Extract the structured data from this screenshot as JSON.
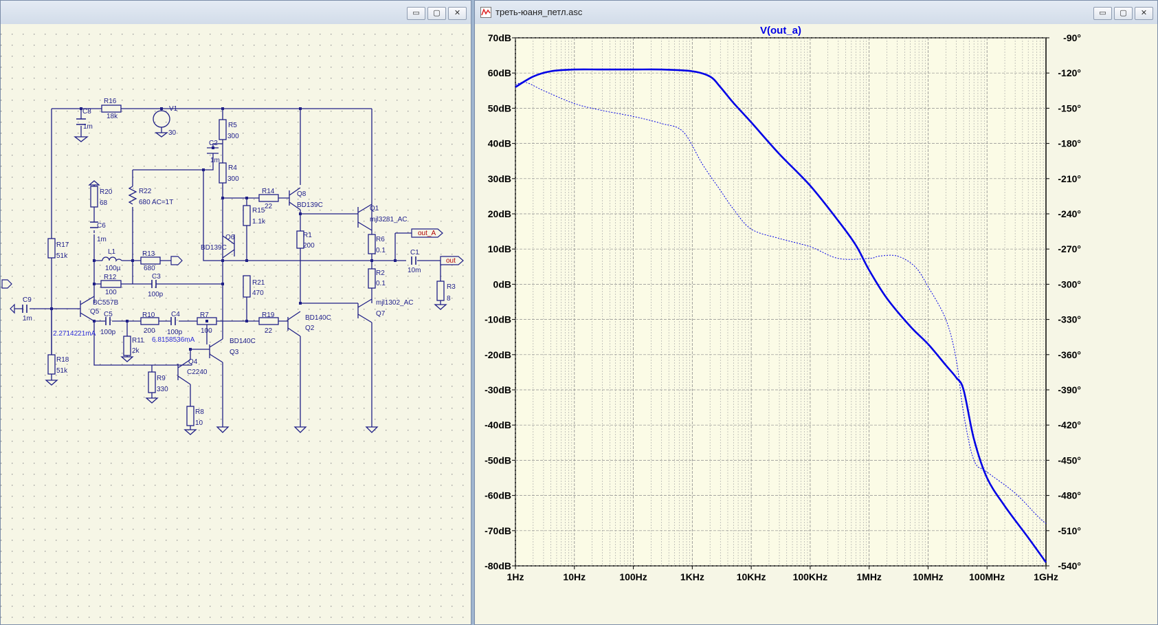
{
  "schematic_window": {
    "buttons": {
      "minimize": "▭",
      "restore": "▢",
      "close": "✕"
    },
    "components": [
      {
        "name": "R16",
        "value": "18k"
      },
      {
        "name": "C8",
        "value": "1m"
      },
      {
        "name": "V1",
        "value": "30"
      },
      {
        "name": "R5",
        "value": "300"
      },
      {
        "name": "C2",
        "value": "1m"
      },
      {
        "name": "R4",
        "value": "300"
      },
      {
        "name": "R20",
        "value": "68"
      },
      {
        "name": "R22",
        "value": "680 AC=1T"
      },
      {
        "name": "R14",
        "value": "22"
      },
      {
        "name": "Q8",
        "value": "BD139C"
      },
      {
        "name": "R15",
        "value": "1.1k"
      },
      {
        "name": "Q1",
        "value": "mjl3281_AC"
      },
      {
        "name": "C6",
        "value": "1m"
      },
      {
        "name": "Q6",
        "value": "BD139C"
      },
      {
        "name": "R1",
        "value": "200"
      },
      {
        "name": "R6",
        "value": "0.1"
      },
      {
        "name": "L1",
        "value": "100µ"
      },
      {
        "name": "R13",
        "value": "680"
      },
      {
        "name": "R17",
        "value": "51k"
      },
      {
        "name": "C1",
        "value": "10m"
      },
      {
        "name": "R12",
        "value": "100"
      },
      {
        "name": "C3",
        "value": "100p"
      },
      {
        "name": "R21",
        "value": "470"
      },
      {
        "name": "R2",
        "value": "0.1"
      },
      {
        "name": "R3",
        "value": "8"
      },
      {
        "name": "C9",
        "value": "1m"
      },
      {
        "name": "Q5",
        "value": "BC557B"
      },
      {
        "name": "Q7",
        "value": "mjl1302_AC"
      },
      {
        "name": "C5",
        "value": "100p"
      },
      {
        "name": "R10",
        "value": "200"
      },
      {
        "name": "C4",
        "value": "100p"
      },
      {
        "name": "R7",
        "value": "100"
      },
      {
        "name": "R19",
        "value": "22"
      },
      {
        "name": "Q2",
        "value": "BD140C"
      },
      {
        "name": "R11",
        "value": "2k"
      },
      {
        "name": "Q3",
        "value": "BD140C"
      },
      {
        "name": "Q4",
        "value": "C2240"
      },
      {
        "name": "R18",
        "value": "51k"
      },
      {
        "name": "R9",
        "value": "330"
      },
      {
        "name": "R8",
        "value": "10"
      }
    ],
    "net_labels": {
      "out_a": "out_A",
      "out": "out"
    },
    "annotations": {
      "current_q5": "2.2714221mA",
      "current_q4": "6.8158536mA"
    }
  },
  "plot_window": {
    "title": "треть-юаня_петл.asc",
    "buttons": {
      "minimize": "▭",
      "restore": "▢",
      "close": "✕"
    },
    "accent_color": "#0000e6",
    "background_color": "#fbfbe6"
  },
  "chart_data": {
    "type": "line",
    "title": "V(out_a)",
    "x_scale": "log",
    "x_ticks": [
      "1Hz",
      "10Hz",
      "100Hz",
      "1KHz",
      "10KHz",
      "100KHz",
      "1MHz",
      "10MHz",
      "100MHz",
      "1GHz"
    ],
    "y_ticks": [
      "70dB",
      "60dB",
      "50dB",
      "40dB",
      "30dB",
      "20dB",
      "10dB",
      "0dB",
      "-10dB",
      "-20dB",
      "-30dB",
      "-40dB",
      "-50dB",
      "-60dB",
      "-70dB",
      "-80dB"
    ],
    "y2_ticks": [
      "-90°",
      "-120°",
      "-150°",
      "-180°",
      "-210°",
      "-240°",
      "-270°",
      "-300°",
      "-330°",
      "-360°",
      "-390°",
      "-420°",
      "-450°",
      "-480°",
      "-510°",
      "-540°"
    ],
    "xlim_hz": [
      1,
      1000000000
    ],
    "ylim_db": [
      -80,
      70
    ],
    "y2lim_deg": [
      -540,
      -90
    ],
    "grid": true,
    "series": [
      {
        "style": "solid",
        "axis": "left",
        "unit": "dB",
        "points": [
          [
            1,
            56
          ],
          [
            2,
            59
          ],
          [
            4,
            60.5
          ],
          [
            10,
            61
          ],
          [
            30,
            61
          ],
          [
            100,
            61
          ],
          [
            300,
            61
          ],
          [
            1000,
            60.5
          ],
          [
            2000,
            59
          ],
          [
            3000,
            56
          ],
          [
            5000,
            51.5
          ],
          [
            10000,
            46
          ],
          [
            30000,
            37
          ],
          [
            100000,
            28
          ],
          [
            300000,
            18
          ],
          [
            600000,
            11
          ],
          [
            1000000,
            4
          ],
          [
            2000000,
            -4
          ],
          [
            5000000,
            -12
          ],
          [
            10000000,
            -17
          ],
          [
            20000000,
            -23
          ],
          [
            30000000,
            -26.5
          ],
          [
            40000000,
            -30
          ],
          [
            60000000,
            -44
          ],
          [
            100000000,
            -55
          ],
          [
            200000000,
            -63
          ],
          [
            500000000,
            -72
          ],
          [
            1000000000,
            -79
          ]
        ]
      },
      {
        "style": "dotted",
        "axis": "right",
        "unit": "°",
        "points": [
          [
            1,
            -130
          ],
          [
            1.5,
            -128
          ],
          [
            3,
            -135
          ],
          [
            10,
            -146
          ],
          [
            30,
            -152
          ],
          [
            100,
            -157
          ],
          [
            300,
            -163
          ],
          [
            700,
            -170
          ],
          [
            1500,
            -198
          ],
          [
            3000,
            -220
          ],
          [
            5000,
            -236
          ],
          [
            10000,
            -253
          ],
          [
            30000,
            -261
          ],
          [
            100000,
            -268
          ],
          [
            300000,
            -278
          ],
          [
            1000000,
            -278
          ],
          [
            1500000,
            -276
          ],
          [
            3000000,
            -276
          ],
          [
            6000000,
            -285
          ],
          [
            10000000,
            -302
          ],
          [
            20000000,
            -330
          ],
          [
            30000000,
            -364
          ],
          [
            40000000,
            -410
          ],
          [
            60000000,
            -450
          ],
          [
            100000000,
            -460
          ],
          [
            300000000,
            -478
          ],
          [
            700000000,
            -497
          ],
          [
            1000000000,
            -504
          ]
        ]
      }
    ]
  }
}
